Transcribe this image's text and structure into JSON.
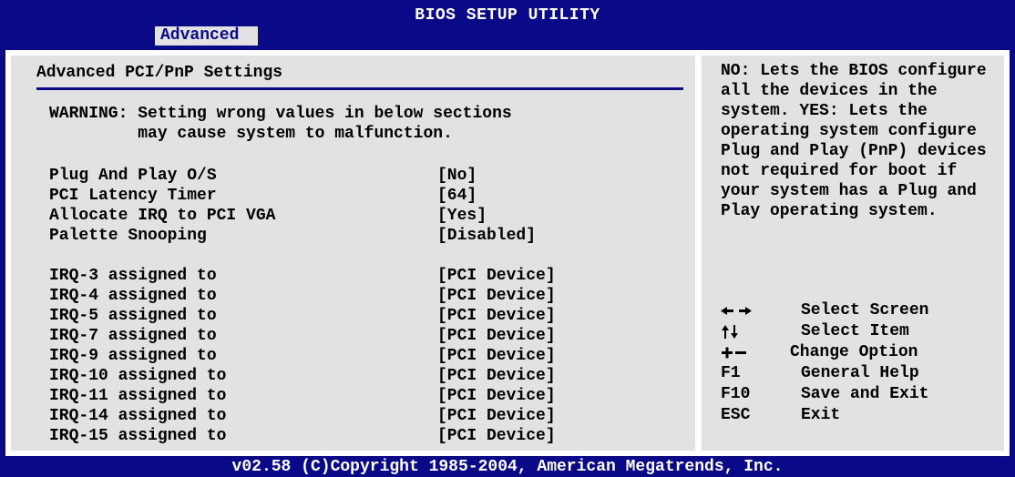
{
  "header": {
    "title": "BIOS SETUP UTILITY",
    "tab": "Advanced"
  },
  "main": {
    "section_title": "Advanced PCI/PnP Settings",
    "warning_line1": "WARNING: Setting wrong values in below sections",
    "warning_line2": "         may cause system to malfunction.",
    "settings": [
      {
        "label": "Plug And Play O/S",
        "value": "[No]"
      },
      {
        "label": "PCI Latency Timer",
        "value": "[64]"
      },
      {
        "label": "Allocate IRQ to PCI VGA",
        "value": "[Yes]"
      },
      {
        "label": "Palette Snooping",
        "value": "[Disabled]"
      }
    ],
    "irqs": [
      {
        "label": "IRQ-3 assigned to",
        "value": "[PCI Device]"
      },
      {
        "label": "IRQ-4 assigned to",
        "value": "[PCI Device]"
      },
      {
        "label": "IRQ-5 assigned to",
        "value": "[PCI Device]"
      },
      {
        "label": "IRQ-7 assigned to",
        "value": "[PCI Device]"
      },
      {
        "label": "IRQ-9 assigned to",
        "value": "[PCI Device]"
      },
      {
        "label": "IRQ-10 assigned to",
        "value": "[PCI Device]"
      },
      {
        "label": "IRQ-11 assigned to",
        "value": "[PCI Device]"
      },
      {
        "label": "IRQ-14 assigned to",
        "value": "[PCI Device]"
      },
      {
        "label": "IRQ-15 assigned to",
        "value": "[PCI Device]"
      }
    ]
  },
  "help": {
    "text": "NO: Lets the BIOS configure all the devices in the system. YES: Lets the operating system configure Plug and Play (PnP) devices not required for boot if your system has a Plug and Play operating system.",
    "keys": [
      {
        "key": "←→",
        "icon": "left-right-arrows-icon",
        "desc": "Select Screen"
      },
      {
        "key": "↑↓",
        "icon": "up-down-arrows-icon",
        "desc": "Select Item"
      },
      {
        "key": "+-",
        "icon": "plus-minus-icon",
        "desc": "Change Option"
      },
      {
        "key": "F1",
        "desc": "General Help"
      },
      {
        "key": "F10",
        "desc": "Save and Exit"
      },
      {
        "key": "ESC",
        "desc": "Exit"
      }
    ]
  },
  "footer": {
    "copyright": "v02.58 (C)Copyright 1985-2004, American Megatrends, Inc."
  },
  "colors": {
    "background": "#0a0a88",
    "panel": "#e2e2e2",
    "frame": "#ffffff",
    "text": "#000000",
    "header_text": "#ffffff"
  }
}
